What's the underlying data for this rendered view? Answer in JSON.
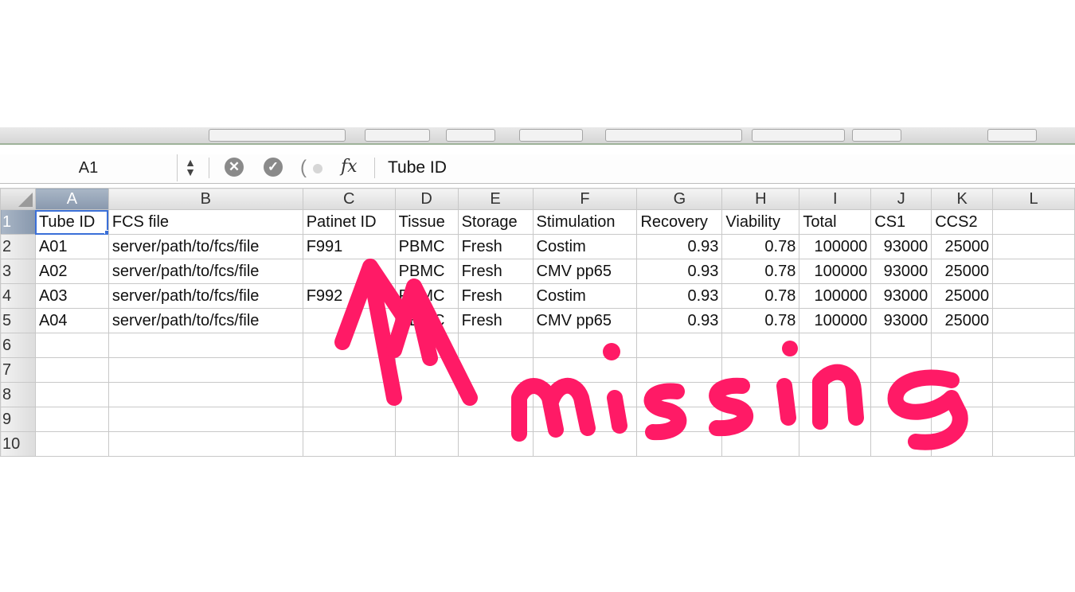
{
  "formula_bar": {
    "name_box": "A1",
    "stepper": "▲▼",
    "cancel_glyph": "✕",
    "confirm_glyph": "✓",
    "fx_label": "fx",
    "content": "Tube ID"
  },
  "columns": [
    "A",
    "B",
    "C",
    "D",
    "E",
    "F",
    "G",
    "H",
    "I",
    "J",
    "K",
    "L"
  ],
  "rows": [
    {
      "num": "1",
      "cells": [
        "Tube ID",
        "FCS file",
        "Patinet ID",
        "Tissue",
        "Storage",
        "Stimulation",
        "Recovery",
        "Viability",
        "Total",
        "CS1",
        "CCS2",
        ""
      ]
    },
    {
      "num": "2",
      "cells": [
        "A01",
        "server/path/to/fcs/file",
        "F991",
        "PBMC",
        "Fresh",
        "Costim",
        "0.93",
        "0.78",
        "100000",
        "93000",
        "25000",
        ""
      ]
    },
    {
      "num": "3",
      "cells": [
        "A02",
        "server/path/to/fcs/file",
        "",
        "PBMC",
        "Fresh",
        "CMV pp65",
        "0.93",
        "0.78",
        "100000",
        "93000",
        "25000",
        ""
      ]
    },
    {
      "num": "4",
      "cells": [
        "A03",
        "server/path/to/fcs/file",
        "F992",
        "PBMC",
        "Fresh",
        "Costim",
        "0.93",
        "0.78",
        "100000",
        "93000",
        "25000",
        ""
      ]
    },
    {
      "num": "5",
      "cells": [
        "A04",
        "server/path/to/fcs/file",
        "",
        "PBMC",
        "Fresh",
        "CMV pp65",
        "0.93",
        "0.78",
        "100000",
        "93000",
        "25000",
        ""
      ]
    },
    {
      "num": "6",
      "cells": [
        "",
        "",
        "",
        "",
        "",
        "",
        "",
        "",
        "",
        "",
        "",
        ""
      ]
    },
    {
      "num": "7",
      "cells": [
        "",
        "",
        "",
        "",
        "",
        "",
        "",
        "",
        "",
        "",
        "",
        ""
      ]
    },
    {
      "num": "8",
      "cells": [
        "",
        "",
        "",
        "",
        "",
        "",
        "",
        "",
        "",
        "",
        "",
        ""
      ]
    },
    {
      "num": "9",
      "cells": [
        "",
        "",
        "",
        "",
        "",
        "",
        "",
        "",
        "",
        "",
        "",
        ""
      ]
    },
    {
      "num": "10",
      "cells": [
        "",
        "",
        "",
        "",
        "",
        "",
        "",
        "",
        "",
        "",
        "",
        ""
      ]
    }
  ],
  "active_cell": "A1",
  "annotation": {
    "text": "missing",
    "color": "#ff1a66"
  },
  "colors": {
    "selection": "#3a6fd8",
    "header_selected": "#8898ad"
  }
}
